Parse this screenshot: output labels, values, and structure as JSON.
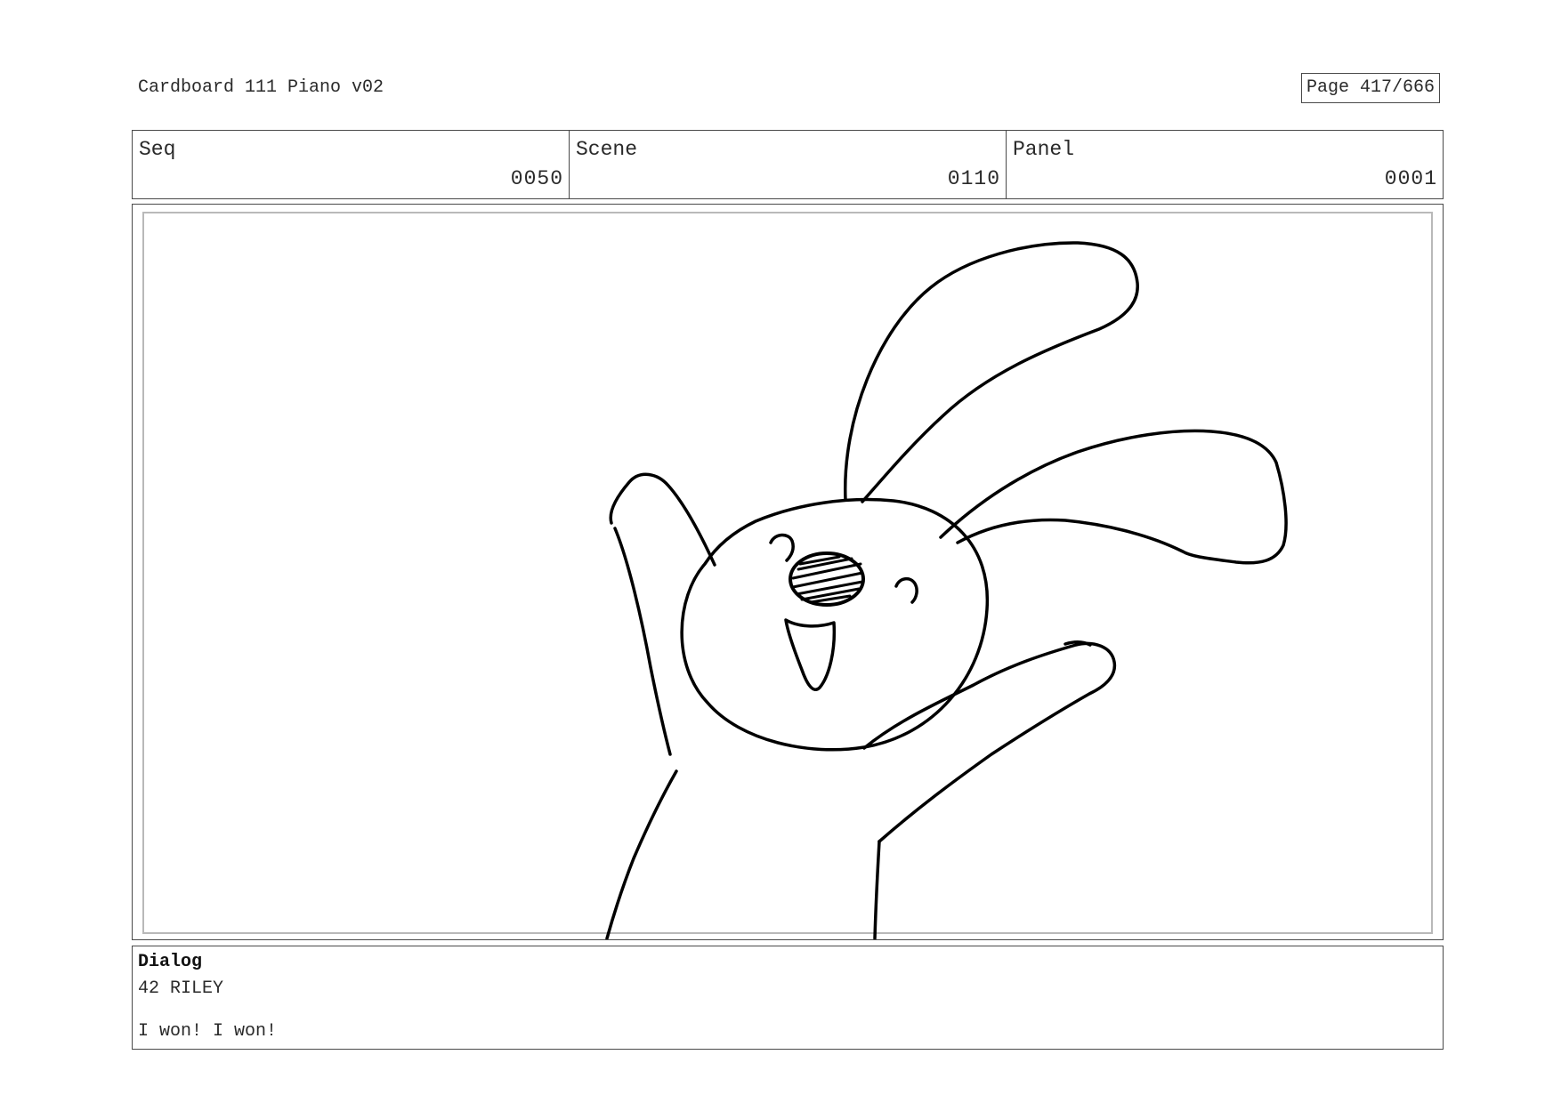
{
  "header": {
    "title": "Cardboard 111 Piano v02",
    "page": "Page 417/666"
  },
  "info": {
    "seq_label": "Seq",
    "seq_value": "0050",
    "scene_label": "Scene",
    "scene_value": "0110",
    "panel_label": "Panel",
    "panel_value": "0001"
  },
  "panel": {
    "sketch": "rabbit-cheering-sketch"
  },
  "dialog": {
    "heading": "Dialog",
    "speaker": "42 RILEY",
    "line": "I won! I won!"
  },
  "colors": {
    "border": "#4a4a4a",
    "inner_frame": "#b9b9b9",
    "ink": "#000000"
  }
}
